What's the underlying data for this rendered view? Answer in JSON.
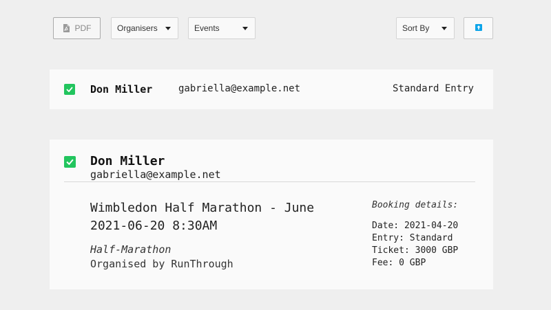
{
  "toolbar": {
    "pdf_label": "PDF",
    "organisers_label": "Organisers",
    "events_label": "Events",
    "sort_label": "Sort By",
    "upload_icon": "upload-icon"
  },
  "colors": {
    "accent_check": "#22c55e",
    "upload_blue": "#0ea5e9"
  },
  "collapsed_card": {
    "checked": true,
    "name": "Don Miller",
    "email": "gabriella@example.net",
    "entry": "Standard Entry"
  },
  "expanded_card": {
    "checked": true,
    "name": "Don Miller",
    "email": "gabriella@example.net",
    "event_title": "Wimbledon Half Marathon - June 2021-06-20 8:30AM",
    "event_type": "Half-Marathon",
    "organiser": "Organised by RunThrough",
    "booking": {
      "title": "Booking details:",
      "date": "Date: 2021-04-20",
      "entry": "Entry: Standard",
      "ticket": "Ticket: 3000 GBP",
      "fee": "Fee: 0 GBP"
    }
  }
}
